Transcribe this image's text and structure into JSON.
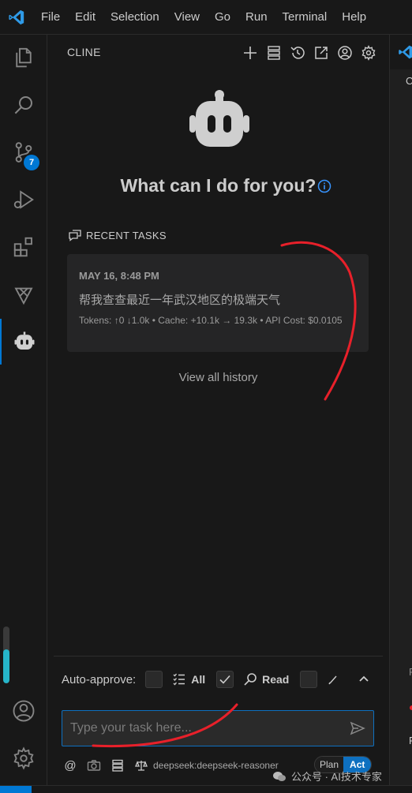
{
  "menu": [
    "File",
    "Edit",
    "Selection",
    "View",
    "Go",
    "Run",
    "Terminal",
    "Help"
  ],
  "activity": {
    "scm_badge": "7",
    "progress_fraction": 0.6
  },
  "panel": {
    "title": "CLINE",
    "header_icons": [
      "plus-icon",
      "server-icon",
      "history-icon",
      "popout-icon",
      "account-icon",
      "gear-icon"
    ],
    "welcome": "What can I do for you?",
    "recent_label": "RECENT TASKS",
    "task": {
      "date": "MAY 16, 8:48 PM",
      "text": "帮我查查最近一年武汉地区的极端天气",
      "meta": "Tokens: ↑0 ↓1.0k • Cache: +10.1k → 19.3k • API Cost: $0.0105"
    },
    "view_history": "View all history"
  },
  "auto_approve": {
    "label": "Auto-approve:",
    "items": [
      {
        "label": "All",
        "checked": false
      },
      {
        "label": "Read",
        "checked": true
      }
    ]
  },
  "input": {
    "placeholder": "Type your task here..."
  },
  "tools": {
    "at": "@",
    "model": "deepseek:deepseek-reasoner"
  },
  "mode": {
    "plan": "Plan",
    "act": "Act"
  },
  "editor": {
    "c1": "C",
    "c2": "F",
    "c3": "F"
  },
  "watermark": "公众号 · AI技术专家",
  "colors": {
    "accent": "#0078d4",
    "annotation": "#e8202a",
    "progress": "#26b5c9"
  }
}
